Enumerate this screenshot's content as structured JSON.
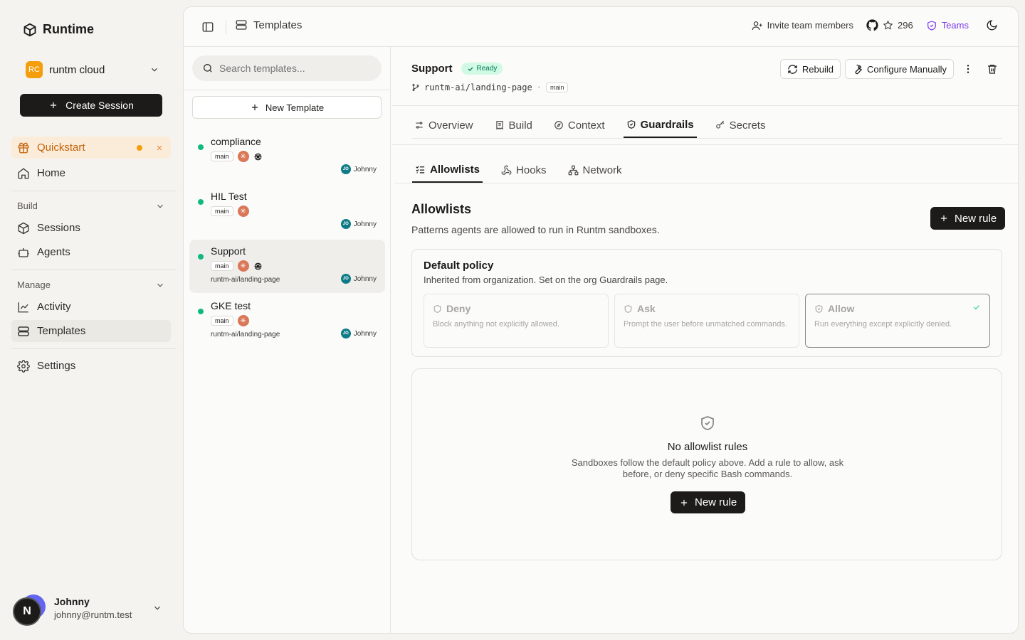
{
  "app": {
    "name": "Runtime"
  },
  "org": {
    "badge": "RC",
    "name": "runtm cloud"
  },
  "sidebar": {
    "create_label": "Create Session",
    "quickstart": "Quickstart",
    "home": "Home",
    "build_section": "Build",
    "sessions": "Sessions",
    "agents": "Agents",
    "manage_section": "Manage",
    "activity": "Activity",
    "templates": "Templates",
    "settings": "Settings"
  },
  "user": {
    "initial": "N",
    "name": "Johnny",
    "email": "johnny@runtm.test"
  },
  "topbar": {
    "breadcrumb": "Templates",
    "invite": "Invite team members",
    "stars": "296",
    "teams": "Teams"
  },
  "list": {
    "search_placeholder": "Search templates...",
    "new_template": "New Template",
    "items": [
      {
        "name": "compliance",
        "branch": "main",
        "repo": "",
        "owner_initials": "JO",
        "owner": "Johnny"
      },
      {
        "name": "HIL Test",
        "branch": "main",
        "repo": "",
        "owner_initials": "JO",
        "owner": "Johnny"
      },
      {
        "name": "Support",
        "branch": "main",
        "repo": "runtm-ai/landing-page",
        "owner_initials": "JO",
        "owner": "Johnny"
      },
      {
        "name": "GKE test",
        "branch": "main",
        "repo": "runtm-ai/landing-page",
        "owner_initials": "JO",
        "owner": "Johnny"
      }
    ]
  },
  "detail": {
    "title": "Support",
    "status": "Ready",
    "repo": "runtm-ai/landing-page",
    "branch": "main",
    "rebuild": "Rebuild",
    "configure": "Configure Manually",
    "tabs": [
      "Overview",
      "Build",
      "Context",
      "Guardrails",
      "Secrets"
    ],
    "subtabs": [
      "Allowlists",
      "Hooks",
      "Network"
    ],
    "section_title": "Allowlists",
    "section_desc": "Patterns agents are allowed to run in Runtm sandboxes.",
    "new_rule": "New rule",
    "policy": {
      "title": "Default policy",
      "desc": "Inherited from organization. Set on the org Guardrails page.",
      "options": [
        {
          "label": "Deny",
          "desc": "Block anything not explicitly allowed."
        },
        {
          "label": "Ask",
          "desc": "Prompt the user before unmatched commands."
        },
        {
          "label": "Allow",
          "desc": "Run everything except explicitly denied."
        }
      ],
      "selected": "Allow"
    },
    "empty": {
      "title": "No allowlist rules",
      "desc": "Sandboxes follow the default policy above. Add a rule to allow, ask before, or deny specific Bash commands.",
      "button": "New rule"
    }
  },
  "colors": {
    "accent": "#1c1b19",
    "ready": "#10b981",
    "teams": "#7c3aed",
    "quickstart": "#c2620a"
  }
}
